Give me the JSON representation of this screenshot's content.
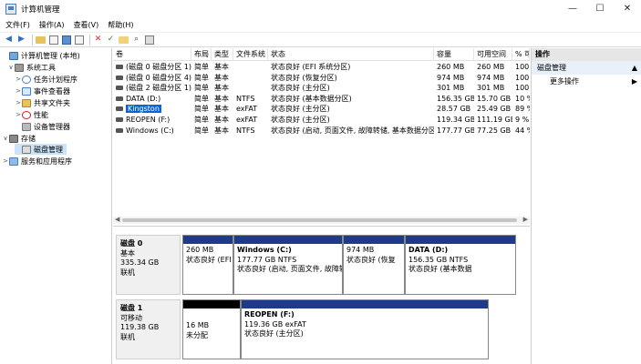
{
  "window": {
    "title": "计算机管理",
    "minimize": "—",
    "maximize": "☐",
    "close": "✕"
  },
  "menu": [
    "文件(F)",
    "操作(A)",
    "查看(V)",
    "帮助(H)"
  ],
  "tree": [
    {
      "label": "计算机管理 (本地)",
      "caret": "",
      "icon": "computer",
      "indent": 0
    },
    {
      "label": "系统工具",
      "caret": "∨",
      "icon": "tools",
      "indent": 1
    },
    {
      "label": "任务计划程序",
      "caret": ">",
      "icon": "clock",
      "indent": 2
    },
    {
      "label": "事件查看器",
      "caret": ">",
      "icon": "event",
      "indent": 2
    },
    {
      "label": "共享文件夹",
      "caret": ">",
      "icon": "folder",
      "indent": 2
    },
    {
      "label": "性能",
      "caret": ">",
      "icon": "perf",
      "indent": 2
    },
    {
      "label": "设备管理器",
      "caret": "",
      "icon": "device",
      "indent": 2
    },
    {
      "label": "存储",
      "caret": "∨",
      "icon": "storage",
      "indent": 1
    },
    {
      "label": "磁盘管理",
      "caret": "",
      "icon": "disk",
      "indent": 2,
      "selected": true
    },
    {
      "label": "服务和应用程序",
      "caret": ">",
      "icon": "services",
      "indent": 1
    }
  ],
  "columns": [
    "卷",
    "布局",
    "类型",
    "文件系统",
    "状态",
    "容量",
    "可用空间",
    "% 可"
  ],
  "volumes": [
    {
      "vol": "(磁盘 0 磁盘分区 1)",
      "layout": "简单",
      "type": "基本",
      "fs": "",
      "status": "状态良好 (EFI 系统分区)",
      "cap": "260 MB",
      "free": "260 MB",
      "pct": "100"
    },
    {
      "vol": "(磁盘 0 磁盘分区 4)",
      "layout": "简单",
      "type": "基本",
      "fs": "",
      "status": "状态良好 (恢复分区)",
      "cap": "974 MB",
      "free": "974 MB",
      "pct": "100"
    },
    {
      "vol": "(磁盘 2 磁盘分区 1)",
      "layout": "简单",
      "type": "基本",
      "fs": "",
      "status": "状态良好 (主分区)",
      "cap": "301 MB",
      "free": "301 MB",
      "pct": "100"
    },
    {
      "vol": "DATA (D:)",
      "layout": "简单",
      "type": "基本",
      "fs": "NTFS",
      "status": "状态良好 (基本数据分区)",
      "cap": "156.35 GB",
      "free": "15.70 GB",
      "pct": "10 %"
    },
    {
      "vol": "Kingston",
      "layout": "简单",
      "type": "基本",
      "fs": "exFAT",
      "status": "状态良好 (主分区)",
      "cap": "28.57 GB",
      "free": "25.49 GB",
      "pct": "89 %",
      "highlight": true
    },
    {
      "vol": "REOPEN (F:)",
      "layout": "简单",
      "type": "基本",
      "fs": "exFAT",
      "status": "状态良好 (主分区)",
      "cap": "119.34 GB",
      "free": "111.19 GB",
      "pct": "9 %"
    },
    {
      "vol": "Windows (C:)",
      "layout": "简单",
      "type": "基本",
      "fs": "NTFS",
      "status": "状态良好 (启动, 页面文件, 故障转储, 基本数据分区)",
      "cap": "177.77 GB",
      "free": "77.25 GB",
      "pct": "44 %"
    }
  ],
  "disks": [
    {
      "name": "磁盘 0",
      "type": "基本",
      "size": "335.34 GB",
      "state": "联机",
      "partitions": [
        {
          "pname": "",
          "line1": "260 MB",
          "line2": "状态良好 (EFI",
          "unalloc": false
        },
        {
          "pname": "Windows  (C:)",
          "line1": "177.77 GB NTFS",
          "line2": "状态良好 (启动, 页面文件, 故障转储,",
          "unalloc": false
        },
        {
          "pname": "",
          "line1": "974 MB",
          "line2": "状态良好 (恢复",
          "unalloc": false
        },
        {
          "pname": "DATA  (D:)",
          "line1": "156.35 GB NTFS",
          "line2": "状态良好 (基本数据",
          "unalloc": false
        }
      ]
    },
    {
      "name": "磁盘 1",
      "type": "可移动",
      "size": "119.38 GB",
      "state": "联机",
      "partitions": [
        {
          "pname": "",
          "line1": "16 MB",
          "line2": "未分配",
          "unalloc": true
        },
        {
          "pname": "REOPEN  (F:)",
          "line1": "119.36 GB exFAT",
          "line2": "状态良好 (主分区)",
          "unalloc": false
        }
      ]
    }
  ],
  "actions": {
    "header": "操作",
    "primary": "磁盘管理",
    "more": "更多操作"
  },
  "icons": [
    "back-arrow-icon",
    "forward-arrow-icon",
    "folder-icon",
    "properties-icon",
    "help-icon",
    "close-icon",
    "check-icon",
    "folder-open-icon",
    "disk-icon"
  ]
}
